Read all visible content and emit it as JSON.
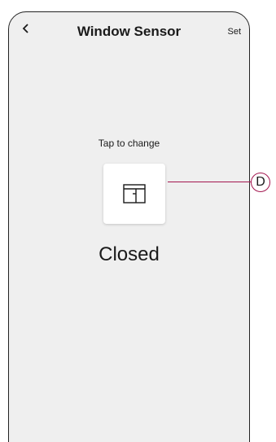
{
  "header": {
    "back_icon": "chevron-left-icon",
    "title": "Window Sensor",
    "action_label": "Set"
  },
  "main": {
    "hint": "Tap to change",
    "state_icon": "window-closed-icon",
    "state_label": "Closed"
  },
  "annotation": {
    "marker_label": "D",
    "accent_color": "#a3164f"
  },
  "colors": {
    "screen_background": "#efefef",
    "tile_background": "#ffffff",
    "text": "#1a1a1a"
  }
}
